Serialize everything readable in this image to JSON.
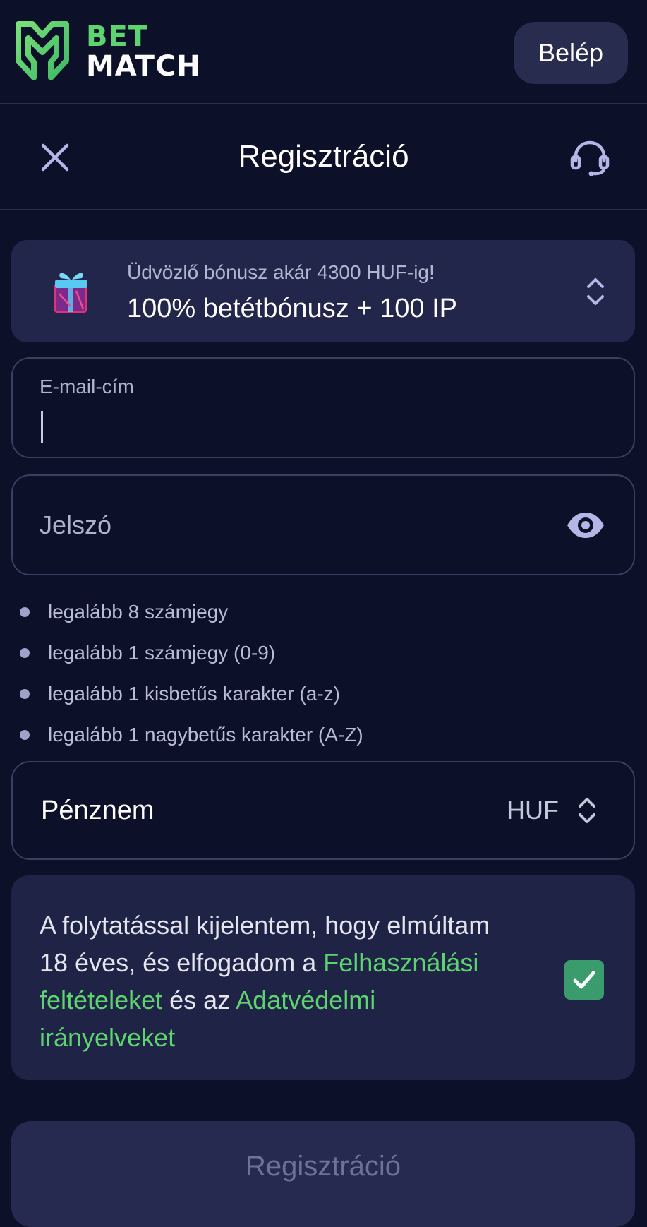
{
  "header": {
    "logo_top": "BET",
    "logo_bottom": "MATCH",
    "login_label": "Belép"
  },
  "titlebar": {
    "title": "Regisztráció",
    "close_icon": "close-icon",
    "support_icon": "headset-icon"
  },
  "bonus": {
    "subtitle": "Üdvözlő bónusz akár 4300 HUF-ig!",
    "title": "100% betétbónusz + 100 IP",
    "icon": "gift-icon"
  },
  "form": {
    "email": {
      "label": "E-mail-cím",
      "value": ""
    },
    "password": {
      "placeholder": "Jelszó"
    },
    "requirements": [
      "legalább 8 számjegy",
      "legalább 1 számjegy (0-9)",
      "legalább 1 kisbetűs karakter (a-z)",
      "legalább 1 nagybetűs karakter (A-Z)"
    ],
    "currency": {
      "label": "Pénznem",
      "value": "HUF"
    },
    "consent": {
      "text_1": "A folytatással kijelentem, hogy elmúltam 18 éves, és elfogadom a ",
      "terms_link": "Felhasználási feltételeket",
      "text_2": " és az ",
      "privacy_link": "Adatvédelmi irányelveket",
      "checked": true
    },
    "submit_label": "Regisztráció"
  },
  "colors": {
    "background": "#0c1029",
    "accent_green": "#5ed470",
    "card": "#22264a",
    "checkbox": "#3a9c6c"
  }
}
